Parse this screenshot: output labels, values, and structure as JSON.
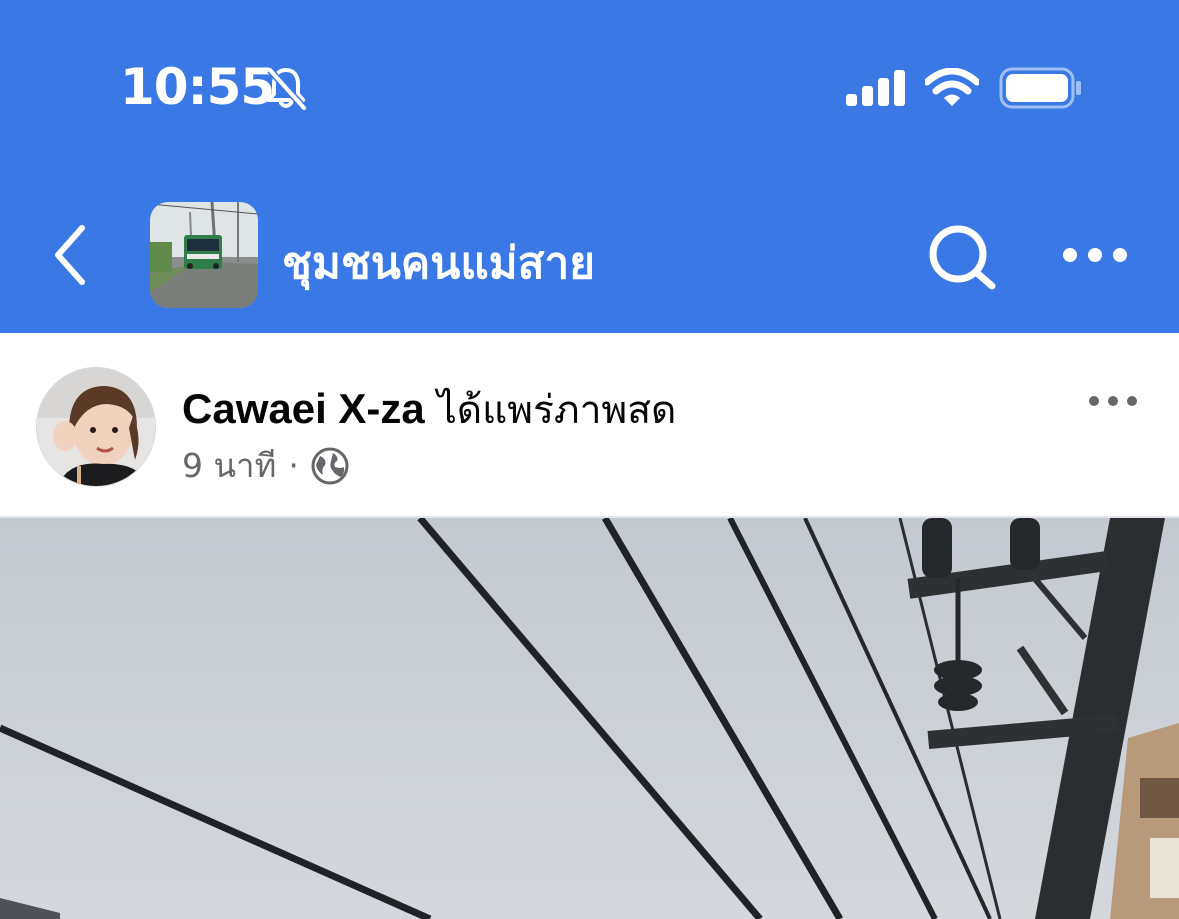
{
  "status_bar": {
    "time": "10:55",
    "mute_icon": "bell-slash-icon",
    "signal_icon": "cellular-signal-icon",
    "wifi_icon": "wifi-icon",
    "battery_icon": "battery-icon"
  },
  "nav": {
    "back_icon": "chevron-left-icon",
    "group_name": "ชุมชนคนแม่สาย",
    "search_icon": "search-icon",
    "more_icon": "more-horizontal-icon"
  },
  "post": {
    "author": "Cawaei X-za",
    "action": "ได้แพร่ภาพสด",
    "time_ago": "9 นาที",
    "separator": "·",
    "privacy_icon": "globe-icon",
    "more_icon": "more-horizontal-icon"
  },
  "colors": {
    "header_bg": "#3a78e6",
    "text_primary": "#050505",
    "text_secondary": "#65676b"
  }
}
